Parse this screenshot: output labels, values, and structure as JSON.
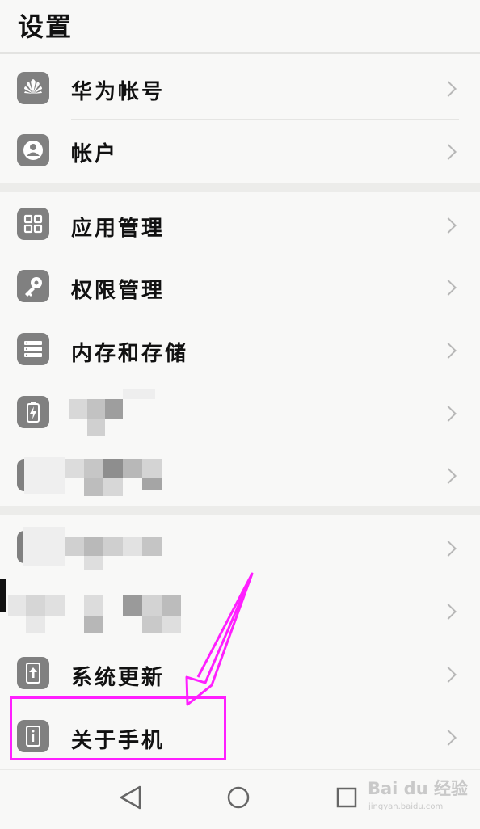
{
  "header": {
    "title": "设置"
  },
  "rows": [
    {
      "label": "华为帐号",
      "icon": "huawei-logo-icon"
    },
    {
      "label": "帐户",
      "icon": "account-icon"
    },
    {
      "label": "应用管理",
      "icon": "apps-grid-icon"
    },
    {
      "label": "权限管理",
      "icon": "key-icon"
    },
    {
      "label": "内存和存储",
      "icon": "storage-list-icon"
    },
    {
      "label": "",
      "icon": "battery-icon"
    },
    {
      "label": "",
      "icon": "settings-icon"
    },
    {
      "label": "",
      "icon": "settings-icon"
    },
    {
      "label": "",
      "icon": "settings-icon"
    },
    {
      "label": "系统更新",
      "icon": "system-update-icon"
    },
    {
      "label": "关于手机",
      "icon": "about-phone-icon"
    }
  ],
  "navbar": {
    "back": "back-triangle-icon",
    "home": "home-circle-icon",
    "recent": "recent-square-icon"
  },
  "watermark": {
    "brand": "Bai du 经验",
    "url": "jingyan.baidu.com"
  },
  "colors": {
    "highlight": "#ff1fff",
    "arrow": "#ff1fff",
    "icon_bg": "#808080"
  }
}
